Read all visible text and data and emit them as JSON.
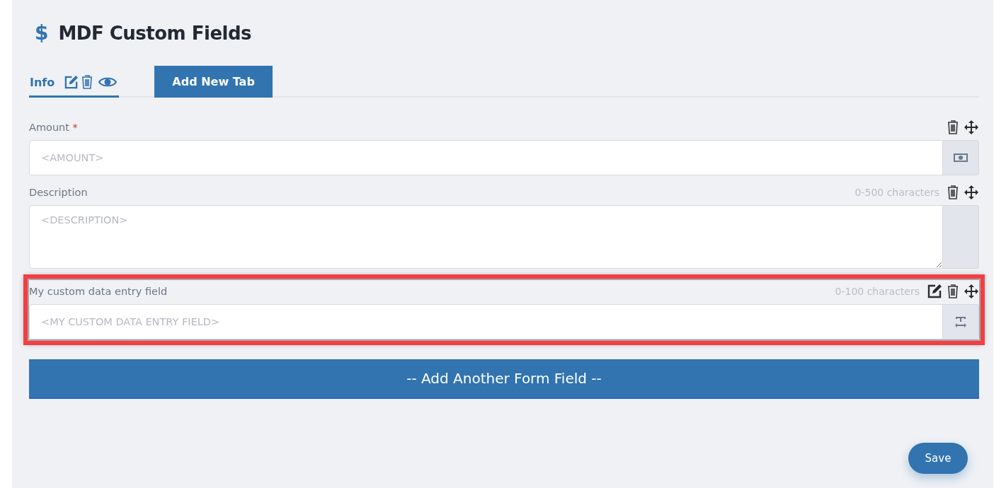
{
  "header": {
    "icon": "$",
    "title": "MDF Custom Fields"
  },
  "tabs": [
    {
      "label": "Info",
      "selected": true
    }
  ],
  "add_tab_button": "Add New Tab",
  "fields": [
    {
      "label": "Amount",
      "required_mark": "*",
      "kind": "input",
      "placeholder": "<AMOUNT>",
      "addon": {
        "kind": "money"
      },
      "editable": false,
      "highlighted": false
    },
    {
      "label": "Description",
      "kind": "textarea",
      "placeholder": "<DESCRIPTION>",
      "hint": "0-500 characters",
      "addon": {
        "kind": "blank"
      },
      "editable": false,
      "highlighted": false
    },
    {
      "label": "My custom data entry field",
      "kind": "input",
      "placeholder": "<MY CUSTOM DATA ENTRY FIELD>",
      "hint": "0-100 characters",
      "addon": {
        "kind": "text"
      },
      "editable": true,
      "highlighted": true
    }
  ],
  "add_field_button": "-- Add Another Form Field --",
  "save_button": "Save"
}
